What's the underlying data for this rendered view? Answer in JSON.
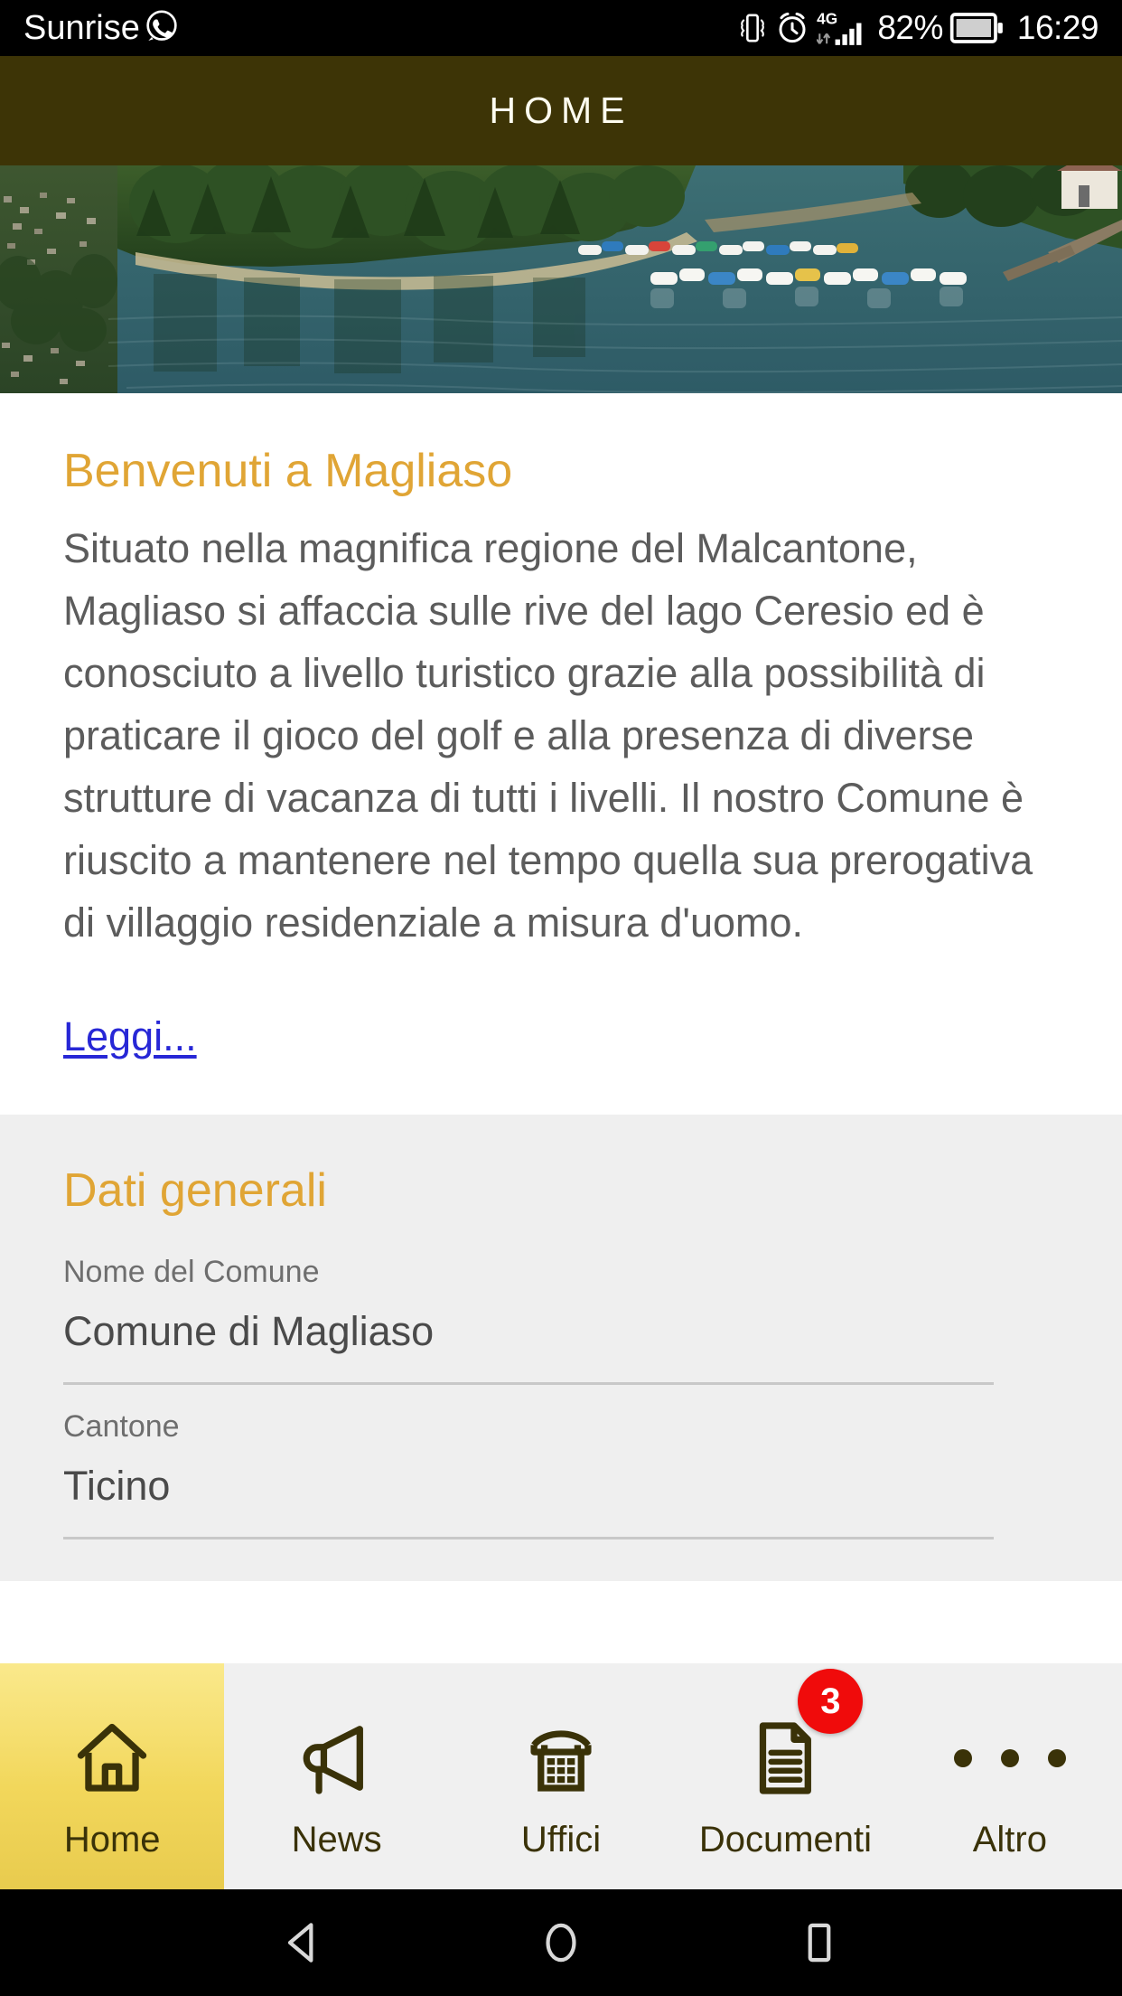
{
  "status_bar": {
    "carrier": "Sunrise",
    "whatsapp_icon": "whatsapp-icon",
    "vibrate_icon": "vibrate-icon",
    "alarm_icon": "alarm-clock-icon",
    "network_type": "4G",
    "signal_icon": "signal-bars-icon",
    "battery_percent": "82%",
    "battery_icon": "battery-icon",
    "clock": "16:29"
  },
  "header": {
    "title": "HOME",
    "background_color": "#3D3406",
    "text_color": "#FFFDF0"
  },
  "hero": {
    "alt": "Aerial view of Magliaso lakefront with moored boats on Lake Ceresio"
  },
  "welcome": {
    "title": "Benvenuti a Magliaso",
    "body": "Situato nella magnifica regione del Malcantone, Magliaso si affaccia sulle rive del lago Ceresio ed è conosciuto a livello turistico grazie alla possibilità di praticare il gioco del golf e alla presenza di diverse strutture di vacanza di tutti i livelli. Il nostro Comune è riuscito a mantenere nel tempo quella sua prerogativa di villaggio residenziale a misura d'uomo.",
    "read_more": "Leggi...",
    "accent_color": "#E0A535",
    "link_color": "#2727D6"
  },
  "general_data": {
    "title": "Dati generali",
    "fields": [
      {
        "label": "Nome del Comune",
        "value": "Comune di Magliaso"
      },
      {
        "label": "Cantone",
        "value": "Ticino"
      }
    ]
  },
  "tab_bar": {
    "active_color": "#F2D75B",
    "badge_color": "#F00B0B",
    "tabs": [
      {
        "label": "Home",
        "icon": "home-icon",
        "active": true,
        "badge": ""
      },
      {
        "label": "News",
        "icon": "megaphone-icon",
        "active": false,
        "badge": ""
      },
      {
        "label": "Uffici",
        "icon": "telephone-icon",
        "active": false,
        "badge": ""
      },
      {
        "label": "Documenti",
        "icon": "document-icon",
        "active": false,
        "badge": "3"
      },
      {
        "label": "Altro",
        "icon": "ellipsis-icon",
        "active": false,
        "badge": ""
      }
    ]
  },
  "android_nav": {
    "back_icon": "back-triangle-icon",
    "home_icon": "home-circle-icon",
    "recents_icon": "recents-square-icon"
  }
}
